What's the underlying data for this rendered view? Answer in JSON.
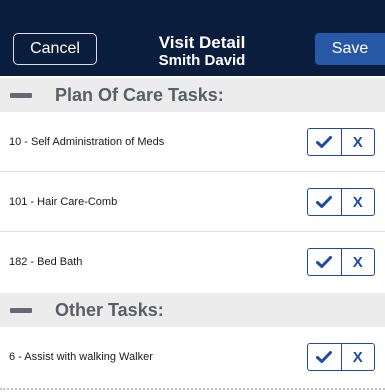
{
  "header": {
    "cancel_label": "Cancel",
    "title": "Visit Detail",
    "subtitle": "Smith David",
    "save_label": "Save",
    "background_color": "#0b1d3c",
    "save_color": "#2758a6"
  },
  "sections": [
    {
      "label": "Plan Of Care Tasks:",
      "tasks": [
        {
          "label": "10 - Self Administration of Meds"
        },
        {
          "label": "101 - Hair Care-Comb"
        },
        {
          "label": "182 - Bed Bath"
        }
      ]
    },
    {
      "label": "Other Tasks:",
      "tasks": [
        {
          "label": "6 - Assist with walking Walker"
        }
      ]
    }
  ],
  "icons": {
    "collapse": "minus-icon",
    "accept": "checkmark-icon",
    "decline_text": "X"
  },
  "accent_color": "#1d4aa8"
}
